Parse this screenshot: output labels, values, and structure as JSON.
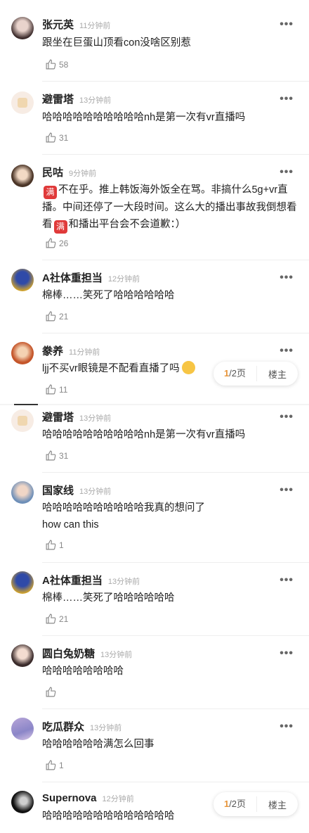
{
  "comments": [
    {
      "name": "张元英",
      "time": "11分钟前",
      "text": "跟坐在巨蛋山顶看con没啥区别惹",
      "likes": "58"
    },
    {
      "name": "避雷塔",
      "time": "13分钟前",
      "text": "哈哈哈哈哈哈哈哈哈哈nh是第一次有vr直播吗",
      "likes": "31"
    },
    {
      "name": "民咕",
      "time": "9分钟前",
      "text_a": "不在乎。推上韩饭海外饭全在骂。非搞什么5g+vr直播。中间还停了一大段时间。这么大的播出事故我倒想看看",
      "text_b": "和播出平台会不会道歉：）",
      "emoji": "满",
      "likes": "26"
    },
    {
      "name": "A社体重担当",
      "time": "12分钟前",
      "text": "棉棒……笑死了哈哈哈哈哈哈",
      "likes": "21"
    },
    {
      "name": "豢养",
      "time": "11分钟前",
      "text": "ljj不买vr眼镜是不配看直播了吗",
      "likes": "11"
    },
    {
      "name": "避雷塔",
      "time": "13分钟前",
      "text": "哈哈哈哈哈哈哈哈哈哈nh是第一次有vr直播吗",
      "likes": "31"
    },
    {
      "name": "国家线",
      "time": "13分钟前",
      "text": "哈哈哈哈哈哈哈哈哈哈我真的想问了",
      "text2": "how can this",
      "likes": "1"
    },
    {
      "name": "A社体重担当",
      "time": "13分钟前",
      "text": "棉棒……笑死了哈哈哈哈哈哈",
      "likes": "21"
    },
    {
      "name": "圆白兔奶糖",
      "time": "13分钟前",
      "text": "哈哈哈哈哈哈哈哈",
      "likes": ""
    },
    {
      "name": "吃瓜群众",
      "time": "13分钟前",
      "text": "哈哈哈哈哈哈满怎么回事",
      "likes": "1"
    },
    {
      "name": "Supernova",
      "time": "12分钟前",
      "text": "哈哈哈哈哈哈哈哈哈哈哈哈哈"
    }
  ],
  "more_label": "•••",
  "pager": {
    "current": "1",
    "total": "/2页",
    "floor_label": "楼主"
  }
}
